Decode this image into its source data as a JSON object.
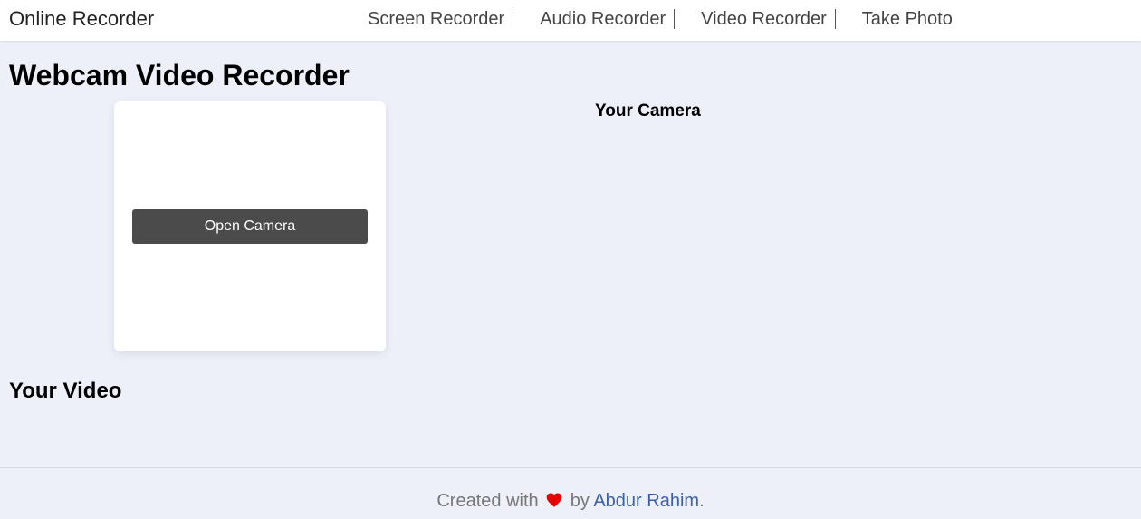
{
  "header": {
    "brand": "Online Recorder",
    "nav": [
      {
        "label": "Screen Recorder"
      },
      {
        "label": "Audio Recorder"
      },
      {
        "label": "Video Recorder"
      },
      {
        "label": "Take Photo"
      }
    ]
  },
  "main": {
    "title": "Webcam Video Recorder",
    "open_camera_label": "Open Camera",
    "camera_heading": "Your Camera",
    "video_heading": "Your Video"
  },
  "footer": {
    "prefix": "Created with",
    "heart_icon": "heart-icon",
    "middle": "by",
    "author": "Abdur Rahim",
    "suffix": ".",
    "heart_color": "#e60000",
    "link_color": "#3d5fa8"
  },
  "colors": {
    "background": "#edf0f8",
    "button": "#4b4b4b"
  }
}
